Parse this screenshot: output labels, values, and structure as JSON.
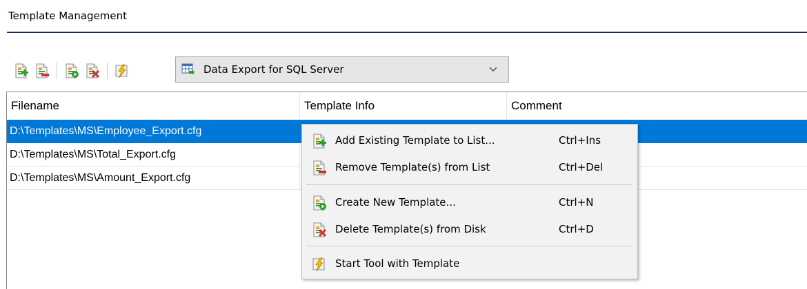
{
  "window": {
    "title": "Template Management"
  },
  "toolbar": {
    "buttons": [
      {
        "icon": "add-template-icon",
        "tooltip": "Add Existing Template to List"
      },
      {
        "icon": "remove-template-icon",
        "tooltip": "Remove Template(s) from List"
      },
      {
        "icon": "create-template-icon",
        "tooltip": "Create New Template"
      },
      {
        "icon": "delete-template-icon",
        "tooltip": "Delete Template(s) from Disk"
      },
      {
        "icon": "start-tool-icon",
        "tooltip": "Start Tool with Template"
      }
    ],
    "tool_select": {
      "value": "Data Export for SQL Server",
      "icon": "data-export-icon"
    }
  },
  "grid": {
    "columns": [
      "Filename",
      "Template Info",
      "Comment"
    ],
    "rows": [
      {
        "filename": "D:\\Templates\\MS\\Employee_Export.cfg",
        "info": "",
        "comment": "",
        "selected": true
      },
      {
        "filename": "D:\\Templates\\MS\\Total_Export.cfg",
        "info": "",
        "comment": "",
        "selected": false
      },
      {
        "filename": "D:\\Templates\\MS\\Amount_Export.cfg",
        "info": "",
        "comment": "",
        "selected": false
      }
    ]
  },
  "context_menu": {
    "items": [
      {
        "label": "Add Existing Template to List...",
        "shortcut": "Ctrl+Ins",
        "icon": "add-template-icon"
      },
      {
        "label": "Remove Template(s) from List",
        "shortcut": "Ctrl+Del",
        "icon": "remove-template-icon"
      },
      {
        "label": "Create New Template...",
        "shortcut": "Ctrl+N",
        "icon": "create-template-icon"
      },
      {
        "label": "Delete Template(s) from Disk",
        "shortcut": "Ctrl+D",
        "icon": "delete-template-icon"
      },
      {
        "label": "Start Tool with Template",
        "shortcut": "",
        "icon": "start-tool-icon"
      }
    ]
  },
  "colors": {
    "selection": "#0078d7",
    "title_rule": "#1b2a6b",
    "menu_background": "#f2f2f2"
  }
}
